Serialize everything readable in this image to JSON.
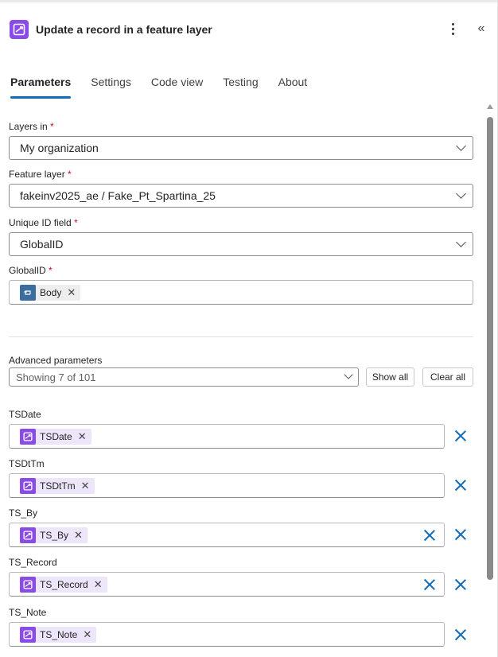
{
  "header": {
    "title": "Update a record in a feature layer"
  },
  "tabs": [
    {
      "label": "Parameters",
      "active": true
    },
    {
      "label": "Settings"
    },
    {
      "label": "Code view"
    },
    {
      "label": "Testing"
    },
    {
      "label": "About"
    }
  ],
  "fields": {
    "layers_in": {
      "label": "Layers in",
      "value": "My organization"
    },
    "feature_layer": {
      "label": "Feature layer",
      "value": "fakeinv2025_ae / Fake_Pt_Spartina_25"
    },
    "unique_id": {
      "label": "Unique ID field",
      "value": "GlobalID"
    },
    "globalid": {
      "label": "GlobalID",
      "token": "Body"
    }
  },
  "required_marker": "*",
  "advanced": {
    "label": "Advanced parameters",
    "value": "Showing 7 of 101",
    "show_all": "Show all",
    "clear_all": "Clear all"
  },
  "params": [
    {
      "label": "TSDate",
      "token": "TSDate"
    },
    {
      "label": "TSDtTm",
      "token": "TSDtTm"
    },
    {
      "label": "TS_By",
      "token": "TS_By"
    },
    {
      "label": "TS_Record",
      "token": "TS_Record"
    },
    {
      "label": "TS_Note",
      "token": "TS_Note"
    }
  ],
  "colors": {
    "accent": "#0f6cbd",
    "token_purple": "#8a4be8",
    "token_blue": "#3b6e9e",
    "required": "#c50f1f"
  }
}
